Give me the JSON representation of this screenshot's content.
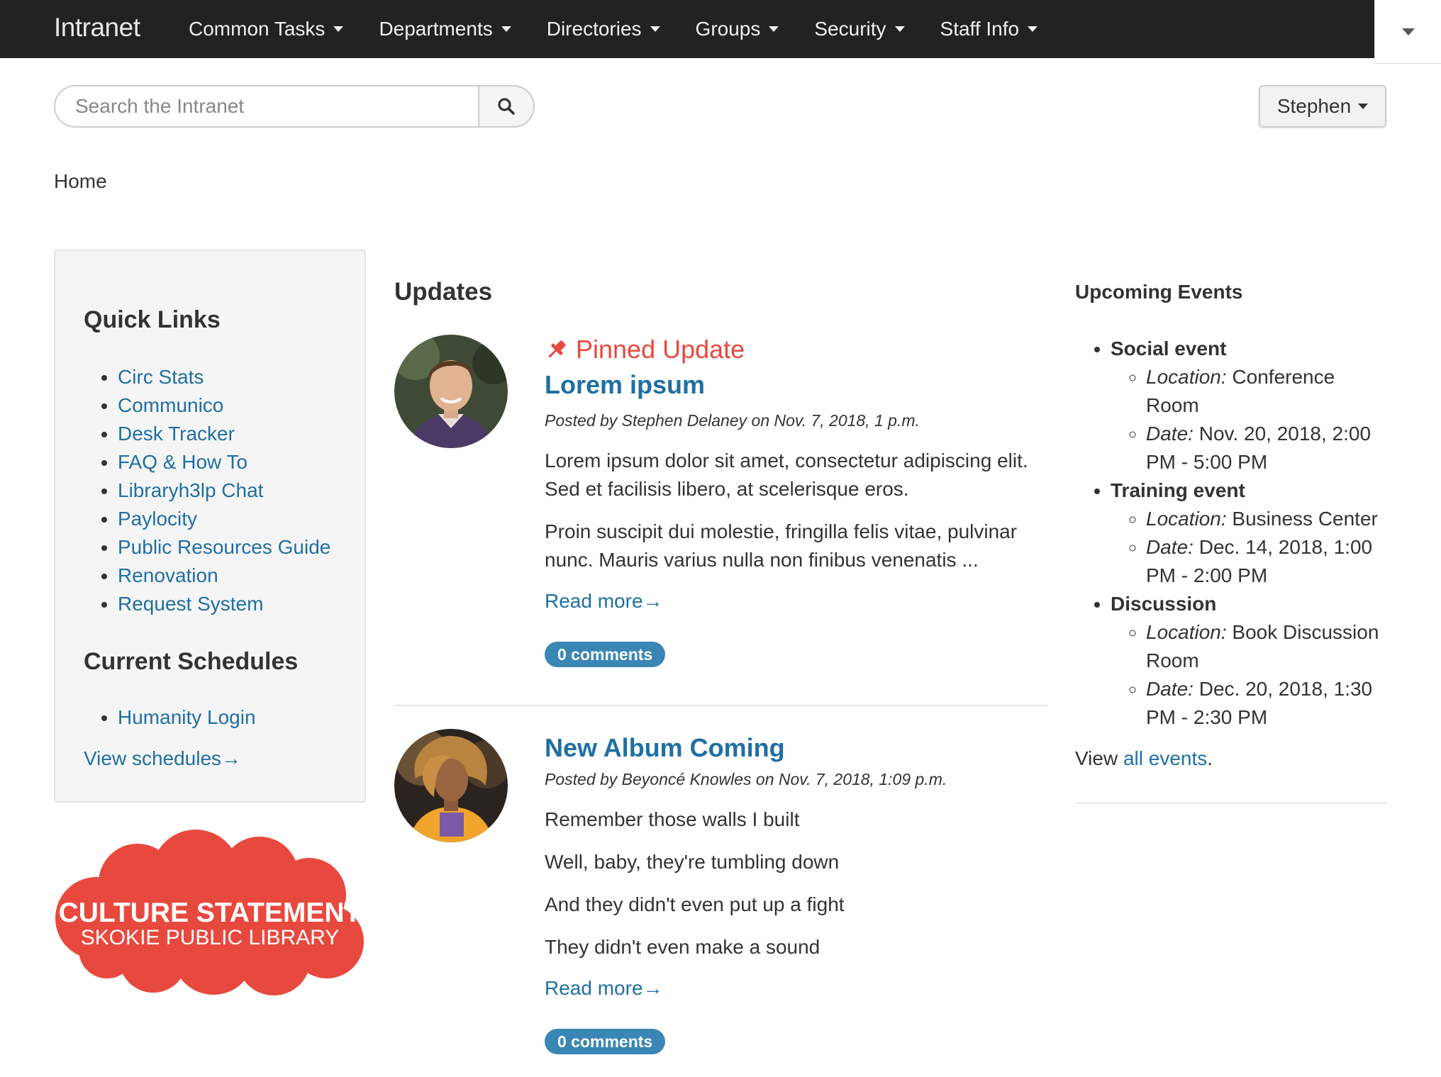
{
  "nav": {
    "brand": "Intranet",
    "items": [
      "Common Tasks",
      "Departments",
      "Directories",
      "Groups",
      "Security",
      "Staff Info"
    ]
  },
  "search": {
    "placeholder": "Search the Intranet"
  },
  "user": {
    "name": "Stephen"
  },
  "breadcrumb": "Home",
  "sidebar": {
    "quick_links_title": "Quick Links",
    "quick_links": [
      "Circ Stats",
      "Communico",
      "Desk Tracker",
      "FAQ & How To",
      "Libraryh3lp Chat",
      "Paylocity",
      "Public Resources Guide",
      "Renovation",
      "Request System"
    ],
    "schedules_title": "Current Schedules",
    "schedules": [
      "Humanity Login"
    ],
    "view_schedules": "View schedules→",
    "logo_line1": "CULTURE STATEMENT",
    "logo_line2": "SKOKIE PUBLIC LIBRARY"
  },
  "updates": {
    "title": "Updates",
    "pinned_label": "Pinned Update",
    "posts": [
      {
        "title": "Lorem ipsum",
        "meta": "Posted by Stephen Delaney on Nov. 7, 2018, 1 p.m.",
        "paragraphs": [
          "Lorem ipsum dolor sit amet, consectetur adipiscing elit. Sed et facilisis libero, at scelerisque eros.",
          "Proin suscipit dui molestie, fringilla felis vitae, pulvinar nunc. Mauris varius nulla non finibus venenatis ..."
        ],
        "read_more": "Read more→",
        "comments": "0 comments"
      },
      {
        "title": "New Album Coming",
        "meta": "Posted by Beyoncé Knowles on Nov. 7, 2018, 1:09 p.m.",
        "paragraphs": [
          "Remember those walls I built",
          "Well, baby, they're tumbling down",
          "And they didn't even put up a fight",
          "They didn't even make a sound"
        ],
        "read_more": "Read more→",
        "comments": "0 comments"
      }
    ]
  },
  "events": {
    "title": "Upcoming Events",
    "location_label": "Location:",
    "date_label": "Date:",
    "items": [
      {
        "name": "Social event",
        "location": "Conference Room",
        "date": "Nov. 20, 2018, 2:00 PM - 5:00 PM"
      },
      {
        "name": "Training event",
        "location": "Business Center",
        "date": "Dec. 14, 2018, 1:00 PM - 2:00 PM"
      },
      {
        "name": "Discussion",
        "location": "Book Discussion Room",
        "date": "Dec. 20, 2018, 1:30 PM - 2:30 PM"
      }
    ],
    "view_prefix": "View",
    "view_link": "all events",
    "view_suffix": "."
  },
  "colors": {
    "link": "#1f6fa3",
    "pinned": "#e8493e",
    "badge": "#3a86b4",
    "navbar": "#222222",
    "logo": "#e8493e"
  },
  "icons": {
    "search": "search-icon",
    "pin": "pushpin-icon",
    "caret": "caret-down-icon"
  }
}
